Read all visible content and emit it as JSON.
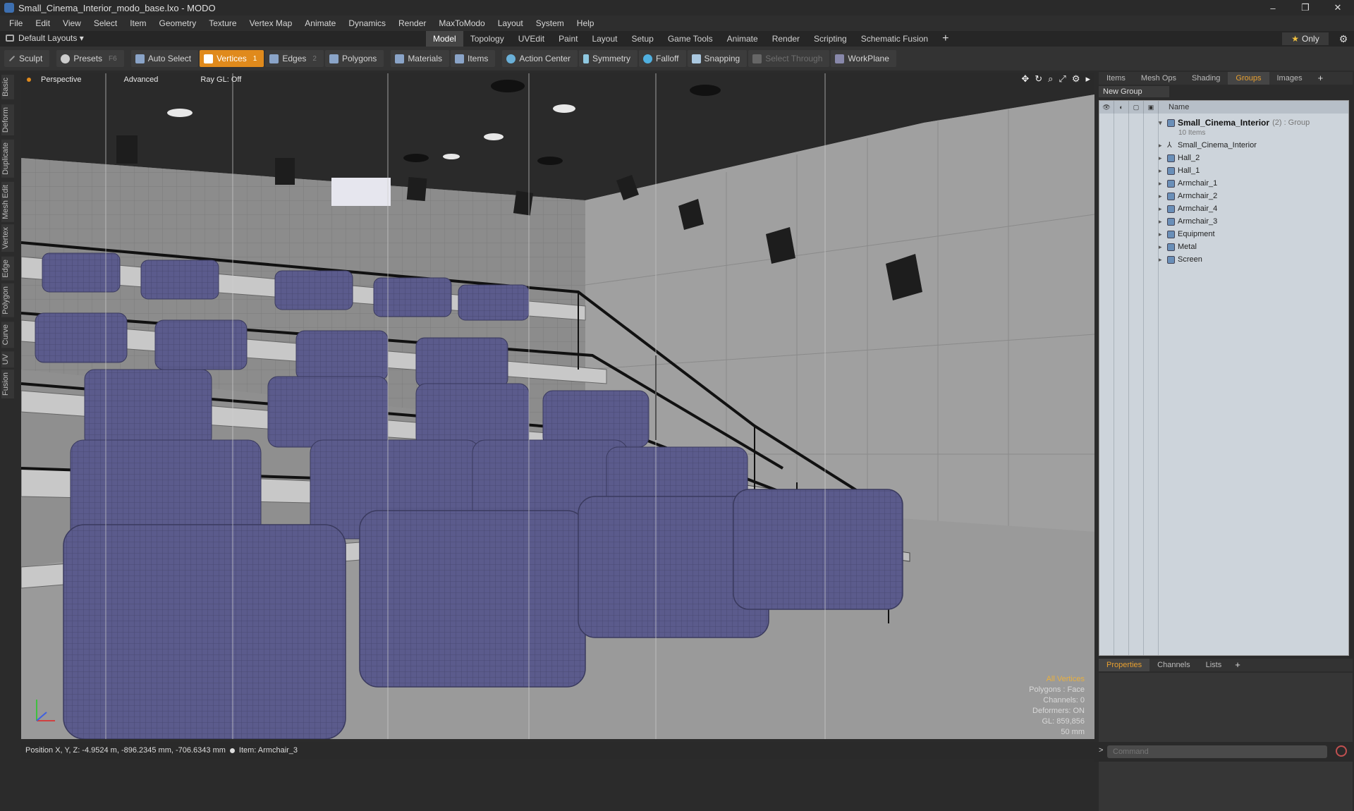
{
  "window": {
    "title": "Small_Cinema_Interior_modo_base.lxo - MODO",
    "minimize": "–",
    "restore": "❐",
    "close": "✕"
  },
  "menu": [
    "File",
    "Edit",
    "View",
    "Select",
    "Item",
    "Geometry",
    "Texture",
    "Vertex Map",
    "Animate",
    "Dynamics",
    "Render",
    "MaxToModo",
    "Layout",
    "System",
    "Help"
  ],
  "layout": {
    "name": "Default Layouts ▾"
  },
  "tabs": [
    "Model",
    "Topology",
    "UVEdit",
    "Paint",
    "Layout",
    "Setup",
    "Game Tools",
    "Animate",
    "Render",
    "Scripting",
    "Schematic Fusion"
  ],
  "tabs_active": "Model",
  "only": {
    "star": "★",
    "label": "Only"
  },
  "toolbar": {
    "sculpt": "Sculpt",
    "presets": "Presets",
    "presets_hotkey": "F6",
    "auto_select": "Auto Select",
    "vertices": "Vertices",
    "vertices_count": "1",
    "edges": "Edges",
    "edges_count": "2",
    "polygons": "Polygons",
    "materials": "Materials",
    "items": "Items",
    "action_center": "Action Center",
    "symmetry": "Symmetry",
    "falloff": "Falloff",
    "snapping": "Snapping",
    "select_through": "Select Through",
    "workplane": "WorkPlane"
  },
  "left_tabs": [
    "Basic",
    "Deform",
    "Duplicate",
    "Mesh Edit",
    "Vertex",
    "Edge",
    "Polygon",
    "Curve",
    "UV",
    "Fusion"
  ],
  "viewport": {
    "view": "Perspective",
    "shading": "Advanced",
    "raygl": "Ray GL: Off",
    "overlay": {
      "mode": "All Vertices",
      "polygons": "Polygons : Face",
      "channels": "Channels: 0",
      "deformers": "Deformers: ON",
      "gl": "GL: 859,856",
      "size": "50 mm"
    }
  },
  "status": {
    "position": "Position X, Y, Z:  -4.9524 m, -896.2345 mm, -706.6343 mm",
    "item": "Item:  Armchair_3"
  },
  "right_tabs": [
    "Items",
    "Mesh Ops",
    "Shading",
    "Groups",
    "Images"
  ],
  "right_tabs_active": "Groups",
  "new_group": "New Group",
  "list_header": {
    "name": "Name"
  },
  "group": {
    "name": "Small_Cinema_Interior",
    "suffix": "(2) : Group",
    "count": "10 Items"
  },
  "items": [
    "Small_Cinema_Interior",
    "Hall_2",
    "Hall_1",
    "Armchair_1",
    "Armchair_2",
    "Armchair_4",
    "Armchair_3",
    "Equipment",
    "Metal",
    "Screen"
  ],
  "prop_tabs": [
    "Properties",
    "Channels",
    "Lists"
  ],
  "prop_tabs_active": "Properties",
  "command": {
    "placeholder": "Command"
  },
  "colors": {
    "accent": "#e08a1c",
    "viewport_bg": "#8f8f8f",
    "seat": "#5a5a8a"
  }
}
